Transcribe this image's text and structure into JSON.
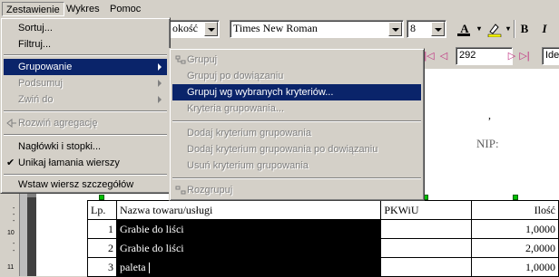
{
  "menubar": {
    "items": [
      "Zestawienie",
      "Wykres",
      "Pomoc"
    ],
    "accent": "#0a246a"
  },
  "toolbar": {
    "size_combo": "okość",
    "font_combo": "Times New Roman",
    "fontsize_combo": "8",
    "bold_label": "B",
    "italic_label": "I",
    "font_color_label": "A",
    "page_number": "292",
    "right_field": "Ide"
  },
  "main_menu": {
    "items": [
      {
        "label": "Sortuj...",
        "enabled": true
      },
      {
        "label": "Filtruj...",
        "enabled": true
      },
      {
        "label": "Grupowanie",
        "enabled": true,
        "highlighted": true,
        "submenu": true
      },
      {
        "label": "Podsumuj",
        "enabled": false,
        "submenu": true
      },
      {
        "label": "Zwiń do",
        "enabled": false,
        "submenu": true
      },
      {
        "label": "Rozwiń agregację",
        "enabled": false
      },
      {
        "label": "Nagłówki i stopki...",
        "enabled": true
      },
      {
        "label": "Unikaj łamania wierszy",
        "enabled": true,
        "checked": true
      },
      {
        "label": "Wstaw wiersz szczegółów",
        "enabled": true
      }
    ]
  },
  "submenu": {
    "items": [
      {
        "label": "Grupuj",
        "enabled": false
      },
      {
        "label": "Grupuj po dowiązaniu",
        "enabled": false
      },
      {
        "label": "Grupuj wg wybranych kryteriów...",
        "enabled": true,
        "highlighted": true
      },
      {
        "label": "Kryteria grupowania...",
        "enabled": false
      },
      {
        "label": "Dodaj kryterium grupowania",
        "enabled": false
      },
      {
        "label": "Dodaj kryterium grupowania po dowiązaniu",
        "enabled": false
      },
      {
        "label": "Usuń kryterium grupowania",
        "enabled": false
      },
      {
        "label": "Rozgrupuj",
        "enabled": false
      }
    ]
  },
  "document": {
    "comma": ",",
    "nip_label": "NIP:",
    "table_headers": [
      "Lp.",
      "Nazwa towaru/usługi",
      "PKWiU",
      "Ilość"
    ],
    "rows": [
      {
        "lp": "1",
        "name": "Grabie do liści",
        "pkwiu": "",
        "qty": "1,0000"
      },
      {
        "lp": "2",
        "name": "Grabie do liści",
        "pkwiu": "",
        "qty": "2,0000"
      },
      {
        "lp": "3",
        "name": "paleta",
        "pkwiu": "",
        "qty": "1,0000"
      }
    ],
    "ruler_numbers": [
      "10",
      "11"
    ]
  }
}
